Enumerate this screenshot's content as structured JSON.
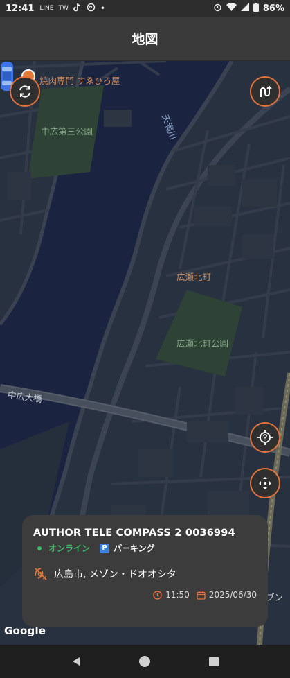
{
  "status_bar": {
    "time": "12:41",
    "indicator_line": "LINE",
    "indicator_tw": "TW",
    "indicator_dot": "•",
    "battery_percent": "86%"
  },
  "app_bar": {
    "title": "地図"
  },
  "map": {
    "labels": {
      "poi_restaurant": "焼肉専門 すゑひろ屋",
      "park_1": "中広第三公園",
      "river": "天満川",
      "district": "広瀬北町",
      "park_2": "広瀬北町公園",
      "bridge": "中広大橋",
      "edge_partial": "ブン"
    },
    "google_logo": "Google",
    "buttons": {
      "refresh": "refresh-icon",
      "route": "route-icon",
      "locate": "locate-icon",
      "fit_bounds": "fit-bounds-icon"
    }
  },
  "info_card": {
    "device_name": "AUTHOR TELE COMPASS 2 0036994",
    "online_status": "オンライン",
    "parking_badge": "P",
    "parking_status": "パーキング",
    "address": "広島市, メゾン・ドオオシタ",
    "time": "11:50",
    "date": "2025/06/30"
  },
  "colors": {
    "accent": "#e4743c",
    "online": "#3fb86a",
    "parking": "#3f7fe0",
    "car": "#3d74e6"
  }
}
